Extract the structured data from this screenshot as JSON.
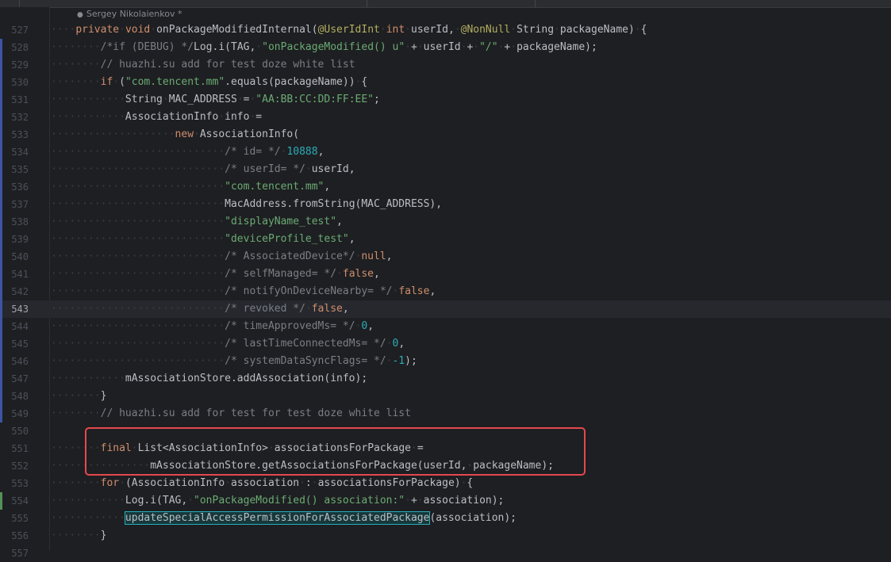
{
  "editor": {
    "author_hint": "Sergey Nikolaienkov *",
    "current_line": "543",
    "lines": [
      {
        "n": "527",
        "change": "",
        "tokens": [
          [
            "ws",
            "····"
          ],
          [
            "kw",
            "private"
          ],
          [
            "ws",
            "·"
          ],
          [
            "kw",
            "void"
          ],
          [
            "ws",
            "·"
          ],
          [
            "t",
            "onPackageModifiedInternal("
          ],
          [
            "ann",
            "@UserIdInt"
          ],
          [
            "ws",
            "·"
          ],
          [
            "kw",
            "int"
          ],
          [
            "ws",
            "·"
          ],
          [
            "t",
            "userId,"
          ],
          [
            "ws",
            "·"
          ],
          [
            "ann",
            "@NonNull"
          ],
          [
            "ws",
            "·"
          ],
          [
            "t",
            "String"
          ],
          [
            "ws",
            "·"
          ],
          [
            "t",
            "packageName)"
          ],
          [
            "ws",
            "·"
          ],
          [
            "t",
            "{"
          ]
        ]
      },
      {
        "n": "528",
        "change": "mod",
        "tokens": [
          [
            "ws",
            "········"
          ],
          [
            "cm",
            "/*if (DEBUG) */"
          ],
          [
            "t",
            "Log.i(TAG,"
          ],
          [
            "ws",
            "·"
          ],
          [
            "str",
            "\"onPackageModified() u\""
          ],
          [
            "ws",
            "·"
          ],
          [
            "t",
            "+"
          ],
          [
            "ws",
            "·"
          ],
          [
            "t",
            "userId"
          ],
          [
            "ws",
            "·"
          ],
          [
            "t",
            "+"
          ],
          [
            "ws",
            "·"
          ],
          [
            "str",
            "\"/\""
          ],
          [
            "ws",
            "·"
          ],
          [
            "t",
            "+"
          ],
          [
            "ws",
            "·"
          ],
          [
            "t",
            "packageName);"
          ]
        ]
      },
      {
        "n": "529",
        "change": "mod",
        "tokens": [
          [
            "ws",
            "········"
          ],
          [
            "cm",
            "// huazhi.su add for test doze white list"
          ]
        ]
      },
      {
        "n": "530",
        "change": "mod",
        "tokens": [
          [
            "ws",
            "········"
          ],
          [
            "kw",
            "if"
          ],
          [
            "ws",
            "·"
          ],
          [
            "t",
            "("
          ],
          [
            "str",
            "\"com.tencent.mm\""
          ],
          [
            "t",
            ".equals(packageName))"
          ],
          [
            "ws",
            "·"
          ],
          [
            "t",
            "{"
          ]
        ]
      },
      {
        "n": "531",
        "change": "mod",
        "tokens": [
          [
            "ws",
            "············"
          ],
          [
            "t",
            "String"
          ],
          [
            "ws",
            "·"
          ],
          [
            "t",
            "MAC_ADDRESS"
          ],
          [
            "ws",
            "·"
          ],
          [
            "t",
            "="
          ],
          [
            "ws",
            "·"
          ],
          [
            "str",
            "\"AA:BB:CC:DD:FF:EE\""
          ],
          [
            "t",
            ";"
          ]
        ]
      },
      {
        "n": "532",
        "change": "mod",
        "tokens": [
          [
            "ws",
            "············"
          ],
          [
            "t",
            "AssociationInfo"
          ],
          [
            "ws",
            "·"
          ],
          [
            "t",
            "info"
          ],
          [
            "ws",
            "·"
          ],
          [
            "t",
            "="
          ]
        ]
      },
      {
        "n": "533",
        "change": "mod",
        "tokens": [
          [
            "ws",
            "····················"
          ],
          [
            "kw",
            "new"
          ],
          [
            "ws",
            "·"
          ],
          [
            "t",
            "AssociationInfo("
          ]
        ]
      },
      {
        "n": "534",
        "change": "mod",
        "tokens": [
          [
            "ws",
            "····························"
          ],
          [
            "cm",
            "/* id= */"
          ],
          [
            "ws",
            "·"
          ],
          [
            "num",
            "10888"
          ],
          [
            "t",
            ","
          ]
        ]
      },
      {
        "n": "535",
        "change": "mod",
        "tokens": [
          [
            "ws",
            "····························"
          ],
          [
            "cm",
            "/* userId= */"
          ],
          [
            "ws",
            "·"
          ],
          [
            "t",
            "userId,"
          ]
        ]
      },
      {
        "n": "536",
        "change": "mod",
        "tokens": [
          [
            "ws",
            "····························"
          ],
          [
            "str",
            "\"com.tencent.mm\""
          ],
          [
            "t",
            ","
          ]
        ]
      },
      {
        "n": "537",
        "change": "mod",
        "tokens": [
          [
            "ws",
            "····························"
          ],
          [
            "t",
            "MacAddress.fromString(MAC_ADDRESS),"
          ]
        ]
      },
      {
        "n": "538",
        "change": "mod",
        "tokens": [
          [
            "ws",
            "····························"
          ],
          [
            "str",
            "\"displayName_test\""
          ],
          [
            "t",
            ","
          ]
        ]
      },
      {
        "n": "539",
        "change": "mod",
        "tokens": [
          [
            "ws",
            "····························"
          ],
          [
            "str",
            "\"deviceProfile_test\""
          ],
          [
            "t",
            ","
          ]
        ]
      },
      {
        "n": "540",
        "change": "mod",
        "tokens": [
          [
            "ws",
            "····························"
          ],
          [
            "cm",
            "/* AssociatedDevice*/"
          ],
          [
            "ws",
            "·"
          ],
          [
            "kw",
            "null"
          ],
          [
            "t",
            ","
          ]
        ]
      },
      {
        "n": "541",
        "change": "mod",
        "tokens": [
          [
            "ws",
            "····························"
          ],
          [
            "cm",
            "/* selfManaged= */"
          ],
          [
            "ws",
            "·"
          ],
          [
            "kw",
            "false"
          ],
          [
            "t",
            ","
          ]
        ]
      },
      {
        "n": "542",
        "change": "mod",
        "tokens": [
          [
            "ws",
            "····························"
          ],
          [
            "cm",
            "/* notifyOnDeviceNearby= */"
          ],
          [
            "ws",
            "·"
          ],
          [
            "kw",
            "false"
          ],
          [
            "t",
            ","
          ]
        ]
      },
      {
        "n": "543",
        "change": "mod",
        "tokens": [
          [
            "ws",
            "····························"
          ],
          [
            "cm",
            "/* revoked */"
          ],
          [
            "ws",
            "·"
          ],
          [
            "kw",
            "false"
          ],
          [
            "t",
            ","
          ]
        ]
      },
      {
        "n": "544",
        "change": "mod",
        "tokens": [
          [
            "ws",
            "····························"
          ],
          [
            "cm",
            "/* timeApprovedMs= */"
          ],
          [
            "ws",
            "·"
          ],
          [
            "num",
            "0"
          ],
          [
            "t",
            ","
          ]
        ]
      },
      {
        "n": "545",
        "change": "mod",
        "tokens": [
          [
            "ws",
            "····························"
          ],
          [
            "cm",
            "/* lastTimeConnectedMs= */"
          ],
          [
            "ws",
            "·"
          ],
          [
            "num",
            "0"
          ],
          [
            "t",
            ","
          ]
        ]
      },
      {
        "n": "546",
        "change": "mod",
        "tokens": [
          [
            "ws",
            "····························"
          ],
          [
            "cm",
            "/* systemDataSyncFlags= */"
          ],
          [
            "ws",
            "·"
          ],
          [
            "num",
            "-1"
          ],
          [
            "t",
            ");"
          ]
        ]
      },
      {
        "n": "547",
        "change": "mod",
        "tokens": [
          [
            "ws",
            "············"
          ],
          [
            "t",
            "mAssociationStore.addAssociation(info);"
          ]
        ]
      },
      {
        "n": "548",
        "change": "mod",
        "tokens": [
          [
            "ws",
            "········"
          ],
          [
            "t",
            "}"
          ]
        ]
      },
      {
        "n": "549",
        "change": "mod",
        "tokens": [
          [
            "ws",
            "········"
          ],
          [
            "cm",
            "// huazhi.su add for test for test doze white list"
          ]
        ]
      },
      {
        "n": "550",
        "change": "",
        "tokens": []
      },
      {
        "n": "551",
        "change": "",
        "tokens": [
          [
            "ws",
            "········"
          ],
          [
            "kw",
            "final"
          ],
          [
            "ws",
            "·"
          ],
          [
            "t",
            "List<AssociationInfo>"
          ],
          [
            "ws",
            "·"
          ],
          [
            "t",
            "associationsForPackage"
          ],
          [
            "ws",
            "·"
          ],
          [
            "t",
            "="
          ]
        ]
      },
      {
        "n": "552",
        "change": "",
        "tokens": [
          [
            "ws",
            "················"
          ],
          [
            "t",
            "mAssociationStore.getAssociationsForPackage(userId,"
          ],
          [
            "ws",
            "·"
          ],
          [
            "t",
            "packageName);"
          ]
        ]
      },
      {
        "n": "553",
        "change": "",
        "tokens": [
          [
            "ws",
            "········"
          ],
          [
            "kw",
            "for"
          ],
          [
            "ws",
            "·"
          ],
          [
            "t",
            "(AssociationInfo"
          ],
          [
            "ws",
            "·"
          ],
          [
            "t",
            "association"
          ],
          [
            "ws",
            "·"
          ],
          [
            "t",
            ":"
          ],
          [
            "ws",
            "·"
          ],
          [
            "t",
            "associationsForPackage)"
          ],
          [
            "ws",
            "·"
          ],
          [
            "t",
            "{"
          ]
        ]
      },
      {
        "n": "554",
        "change": "add",
        "tokens": [
          [
            "ws",
            "············"
          ],
          [
            "t",
            "Log.i(TAG,"
          ],
          [
            "ws",
            "·"
          ],
          [
            "str",
            "\"onPackageModified() association:\""
          ],
          [
            "ws",
            "·"
          ],
          [
            "t",
            "+"
          ],
          [
            "ws",
            "·"
          ],
          [
            "t",
            "association);"
          ]
        ]
      },
      {
        "n": "555",
        "change": "",
        "tokens": [
          [
            "ws",
            "············"
          ],
          [
            "hl",
            "updateSpecialAccessPermissionForAssociatedPackage"
          ],
          [
            "t",
            "(association);"
          ]
        ]
      },
      {
        "n": "556",
        "change": "",
        "tokens": [
          [
            "ws",
            "········"
          ],
          [
            "t",
            "}"
          ]
        ]
      },
      {
        "n": "557",
        "change": "",
        "tokens": []
      }
    ]
  }
}
